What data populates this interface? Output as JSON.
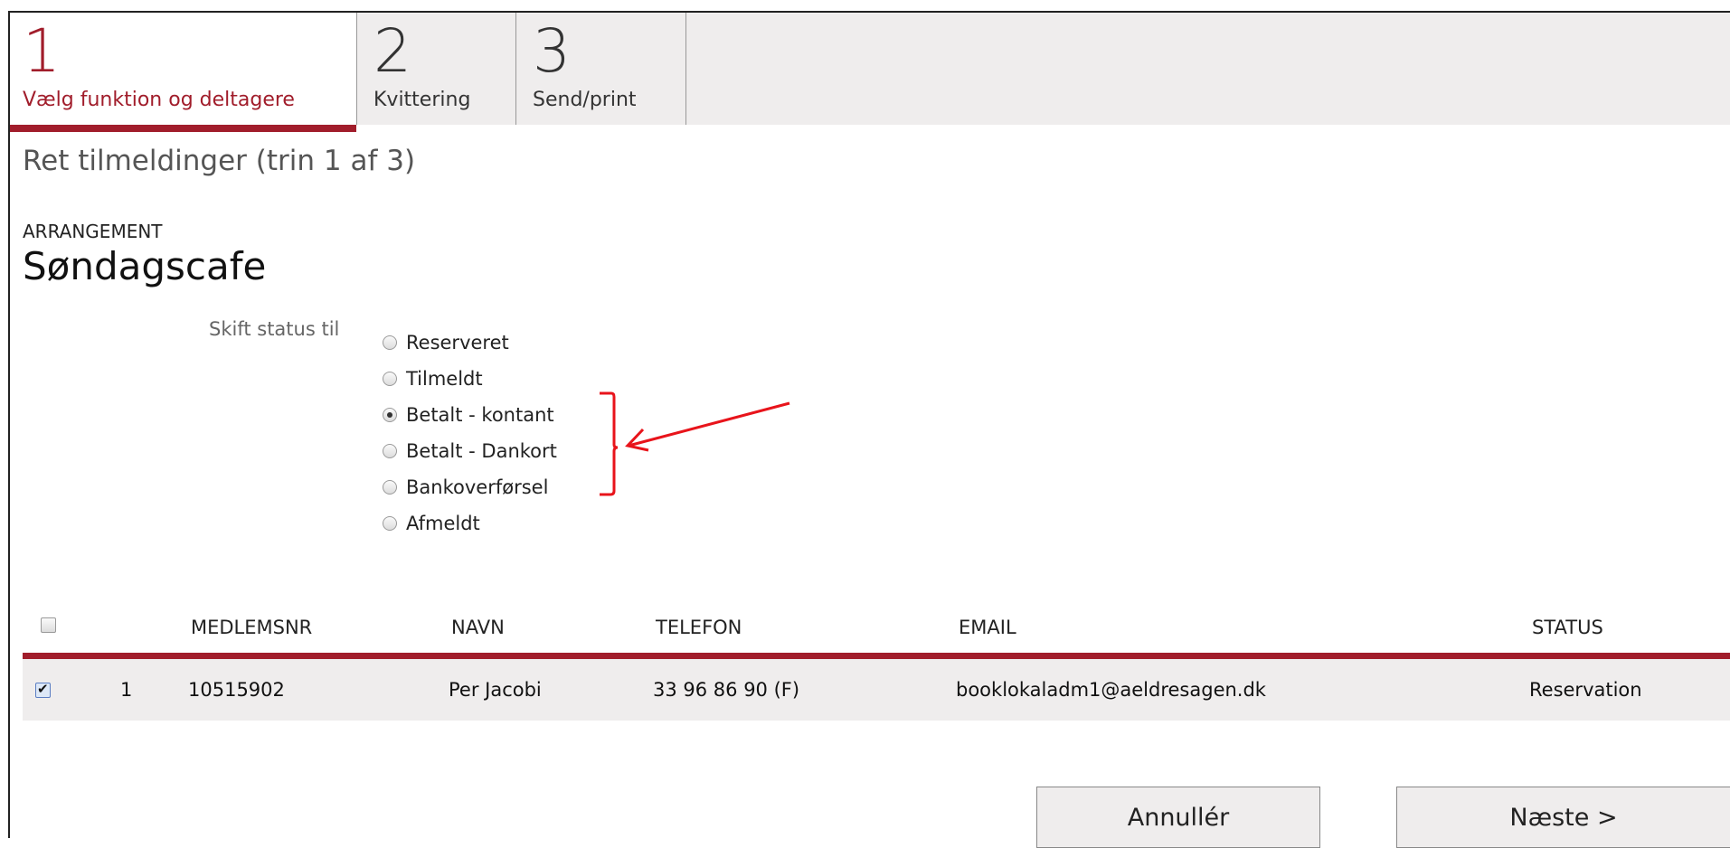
{
  "steps": [
    {
      "num": "1",
      "label": "Vælg funktion og deltagere"
    },
    {
      "num": "2",
      "label": "Kvittering"
    },
    {
      "num": "3",
      "label": "Send/print"
    }
  ],
  "page_title": "Ret tilmeldinger (trin 1 af 3)",
  "event": {
    "section_label": "ARRANGEMENT",
    "name": "Søndagscafe"
  },
  "status_change": {
    "label": "Skift status til",
    "selected": "Betalt - kontant",
    "options": [
      "Reserveret",
      "Tilmeldt",
      "Betalt - kontant",
      "Betalt - Dankort",
      "Bankoverførsel",
      "Afmeldt"
    ]
  },
  "table": {
    "headers": [
      "MEDLEMSNR",
      "NAVN",
      "TELEFON",
      "EMAIL",
      "STATUS"
    ],
    "rows": [
      {
        "index": "1",
        "medlemsnr": "10515902",
        "navn": "Per Jacobi",
        "telefon": "33 96 86 90 (F)",
        "email": "booklokaladm1@aeldresagen.dk",
        "status": "Reservation",
        "checked": true
      }
    ]
  },
  "buttons": {
    "cancel": "Annullér",
    "next": "Næste >"
  },
  "colors": {
    "accent": "#a11d2b",
    "annotation": "#e8141b"
  }
}
